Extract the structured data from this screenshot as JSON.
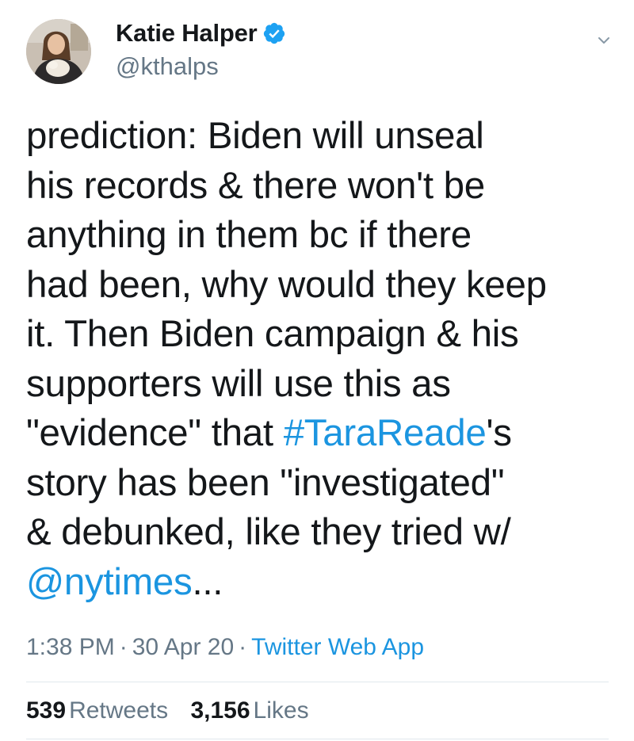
{
  "author": {
    "display_name": "Katie Halper",
    "handle": "@kthalps",
    "verified": true
  },
  "tweet": {
    "lines": [
      [
        {
          "text": "prediction: Biden will unseal"
        }
      ],
      [
        {
          "text": "his records & there won't be"
        }
      ],
      [
        {
          "text": "anything in them bc if there"
        }
      ],
      [
        {
          "text": "had been, why would they keep"
        }
      ],
      [
        {
          "text": "it. Then Biden campaign & his"
        }
      ],
      [
        {
          "text": "supporters will use this as"
        }
      ],
      [
        {
          "text": "\"evidence\" that "
        },
        {
          "text": "#TaraReade",
          "link": true,
          "kind": "hashtag"
        },
        {
          "text": "'s"
        }
      ],
      [
        {
          "text": "story has been \"investigated\""
        }
      ],
      [
        {
          "text": "& debunked, like they tried w/"
        }
      ],
      [
        {
          "text": "@nytimes",
          "link": true,
          "kind": "mention"
        },
        {
          "text": "..."
        }
      ]
    ]
  },
  "meta": {
    "time": "1:38 PM",
    "separator": "·",
    "date": "30 Apr 20",
    "source": "Twitter Web App"
  },
  "stats": {
    "retweets_count": "539",
    "retweets_label": "Retweets",
    "likes_count": "3,156",
    "likes_label": "Likes"
  },
  "colors": {
    "text": "#14171a",
    "secondary": "#657786",
    "link": "#1b95e0",
    "verified_badge": "#1da1f2",
    "divider": "#e1e8ed"
  },
  "icons": {
    "verified": "verified-badge-icon",
    "menu": "chevron-down-icon"
  }
}
